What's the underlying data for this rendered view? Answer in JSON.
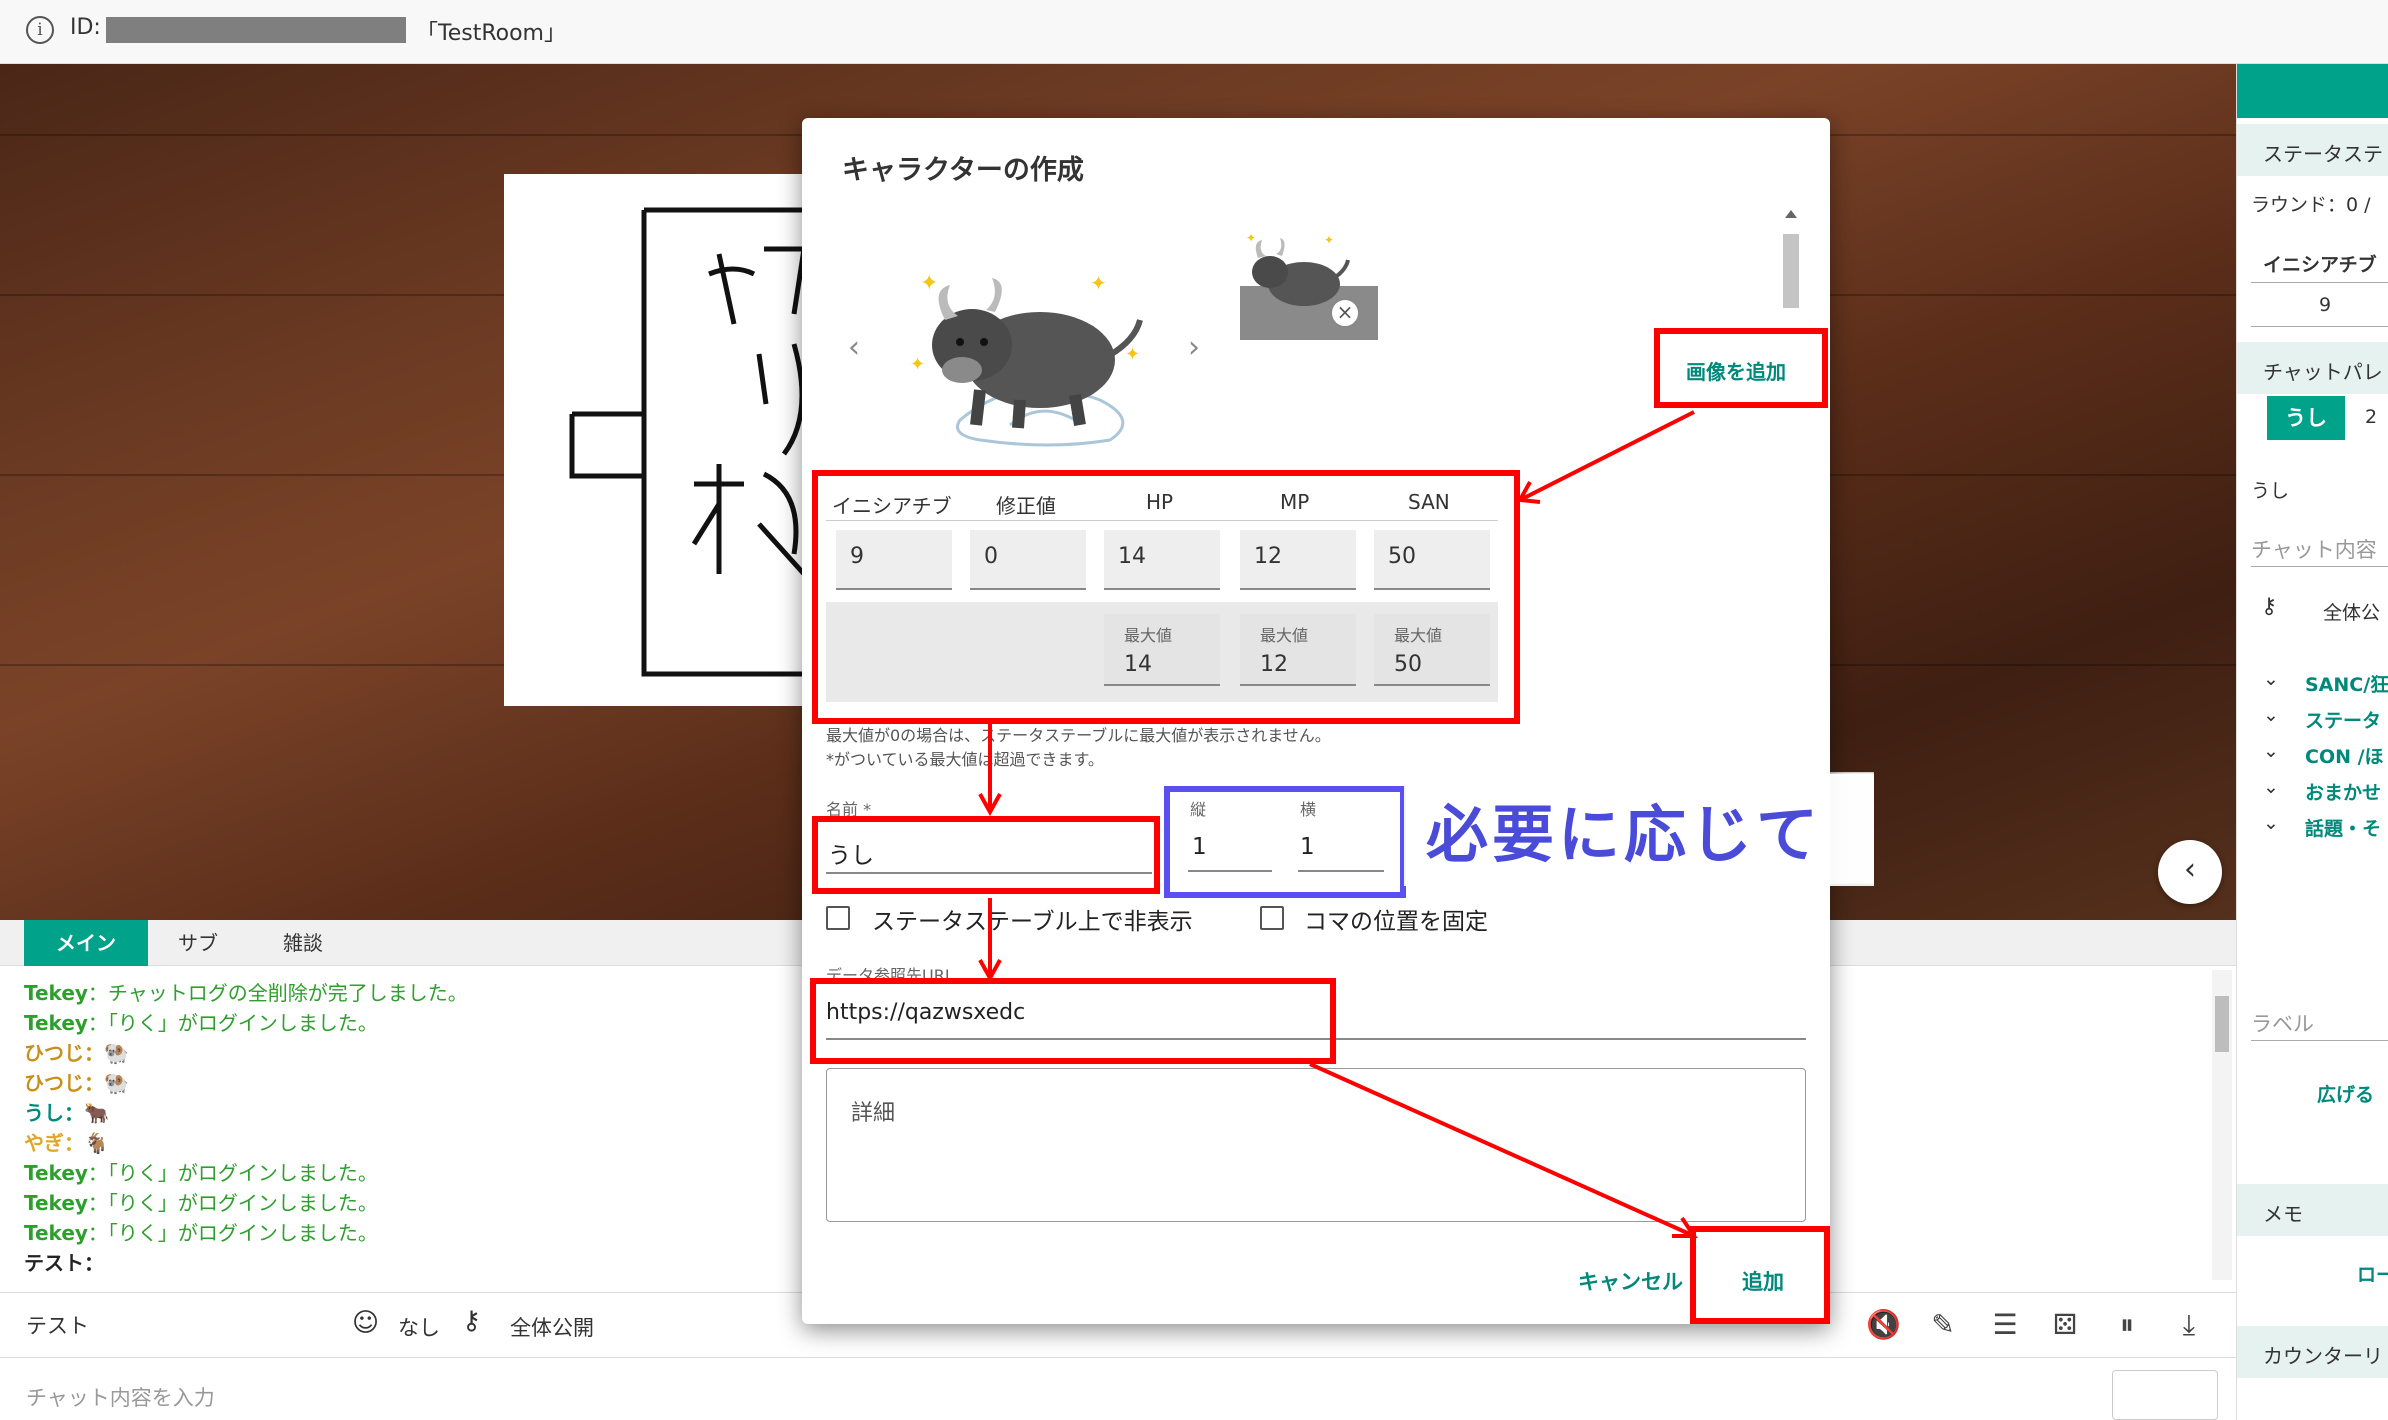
{
  "header": {
    "id_label": "ID:",
    "room_name": "「TestRoom」"
  },
  "right_panel": {
    "status_table_header": "ステータステ",
    "round_text": "ラウンド：0 / ",
    "initiative_header": "イニシアチブ",
    "initiative_value": "9",
    "chat_palette_header": "チャットパレ",
    "palette_tab_active": "うし",
    "palette_tab_2": "2",
    "palette_name": "うし",
    "chat_placeholder": "チャット内容",
    "visibility": "全体公",
    "items": [
      "SANC/狂",
      "ステータ",
      "CON /ほ",
      "おまかせ",
      "話題・そ"
    ],
    "label_placeholder": "ラベル",
    "expand_button": "広げる",
    "memo_header": "メモ",
    "memo_button": "ロー",
    "counter_header": "カウンターリ"
  },
  "chat": {
    "tabs": [
      "メイン",
      "サブ",
      "雑談"
    ],
    "log": [
      {
        "name": "Tekey",
        "text": "：チャットログの全削除が完了しました。",
        "color": "green"
      },
      {
        "name": "Tekey",
        "text": "：「りく」がログインしました。",
        "color": "green"
      },
      {
        "name": "ひつじ",
        "text": "：🐏",
        "color": "orange"
      },
      {
        "name": "ひつじ",
        "text": "：🐏",
        "color": "orange"
      },
      {
        "name": "うし",
        "text": "：🐂",
        "color": "teal"
      },
      {
        "name": "やぎ",
        "text": "：🐐",
        "color": "yellow"
      },
      {
        "name": "Tekey",
        "text": "：「りく」がログインしました。",
        "color": "green"
      },
      {
        "name": "Tekey",
        "text": "：「りく」がログインしました。",
        "color": "green"
      },
      {
        "name": "Tekey",
        "text": "：「りく」がログインしました。",
        "color": "green"
      },
      {
        "name": "テスト",
        "text": "：",
        "color": "black"
      }
    ],
    "sender_name": "テスト",
    "face_option": "なし",
    "visibility": "全体公開",
    "input_placeholder": "チャット内容を入力"
  },
  "modal": {
    "title": "キャラクターの作成",
    "add_image_button": "画像を追加",
    "stat_headers": [
      "イニシアチブ",
      "修正値",
      "HP",
      "MP",
      "SAN"
    ],
    "stat_values": [
      "9",
      "0",
      "14",
      "12",
      "50"
    ],
    "max_label": "最大値",
    "max_values": [
      "14",
      "12",
      "50"
    ],
    "note_line1": "最大値が0の場合は、ステータステーブルに最大値が表示されません。",
    "note_line2": "*がついている最大値は超過できます。",
    "name_label": "名前 *",
    "name_value": "うし",
    "height_label": "縦",
    "height_value": "1",
    "width_label": "横",
    "width_value": "1",
    "hide_checkbox": "ステータステーブル上で非表示",
    "fix_checkbox": "コマの位置を固定",
    "url_label": "データ参照先URL",
    "url_value": "https://qazwsxedc",
    "detail_placeholder": "詳細",
    "cancel_button": "キャンセル",
    "add_button": "追加"
  },
  "annotation": {
    "callout_text": "必要に応じて"
  },
  "colors": {
    "teal": "#00a28a",
    "red_annotation": "#ff0000",
    "blue_annotation": "#5a4ff0"
  }
}
